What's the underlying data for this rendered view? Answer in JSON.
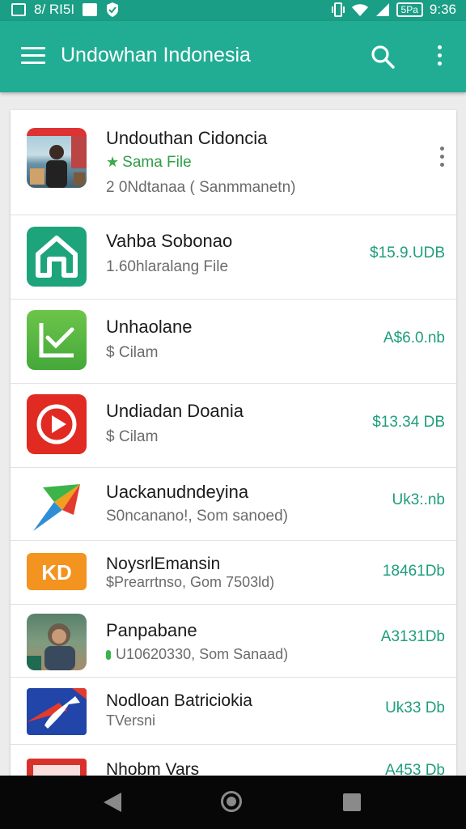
{
  "status_bar": {
    "left_text": "8/ RI5I",
    "battery_text": "5Pa",
    "time": "9:36"
  },
  "app_bar": {
    "title": "Undowhan Indonesia",
    "icons": [
      "menu-icon",
      "search-icon",
      "more-vert-icon"
    ]
  },
  "list": {
    "items": [
      {
        "title": "Undouthan Cidoncia",
        "rating": "Sama File",
        "sub": "2 0Ndtanaa ( Sanmmanetn)",
        "size": "",
        "icon": "photo-person"
      },
      {
        "title": "Vahba Sobonao",
        "sub": "1.60hlaralang File",
        "size": "$15.9.UDB",
        "icon": "house-green"
      },
      {
        "title": "Unhaolane",
        "sub": "$ Cilam",
        "size": "A$6.0.nb",
        "icon": "chart-green"
      },
      {
        "title": "Undiadan Doania",
        "sub": "$ Cilam",
        "size": "$13.34 DB",
        "icon": "play-red"
      },
      {
        "title": "Uackanudndeyina",
        "sub": "S0ncanano!, Som sanoed)",
        "size": "Uk3:.nb",
        "icon": "arrow-colorful"
      },
      {
        "title": "NoysrlEmansin",
        "sub": "$Prearrtnso, Gom 7503ld)",
        "size": "18461Db",
        "icon": "kd-orange"
      },
      {
        "title": "Panpabane",
        "sub": "U10620330, Som Sanaad)",
        "size": "A3131Db",
        "icon": "photo-woman"
      },
      {
        "title": "Nodloan Batriciokia",
        "sub": "TVersni",
        "size": "Uk33 Db",
        "icon": "arrow-blue-red"
      },
      {
        "title": "Nhobm Vars",
        "sub": "",
        "size": "A453 Db",
        "icon": "red-banner"
      }
    ]
  },
  "nav_bar": {
    "icons": [
      "back-icon",
      "home-icon",
      "recent-apps-icon"
    ]
  },
  "colors": {
    "app_bar": "#21ad94",
    "status_bar": "#1a9e86",
    "size_text": "#1e9e7c"
  }
}
